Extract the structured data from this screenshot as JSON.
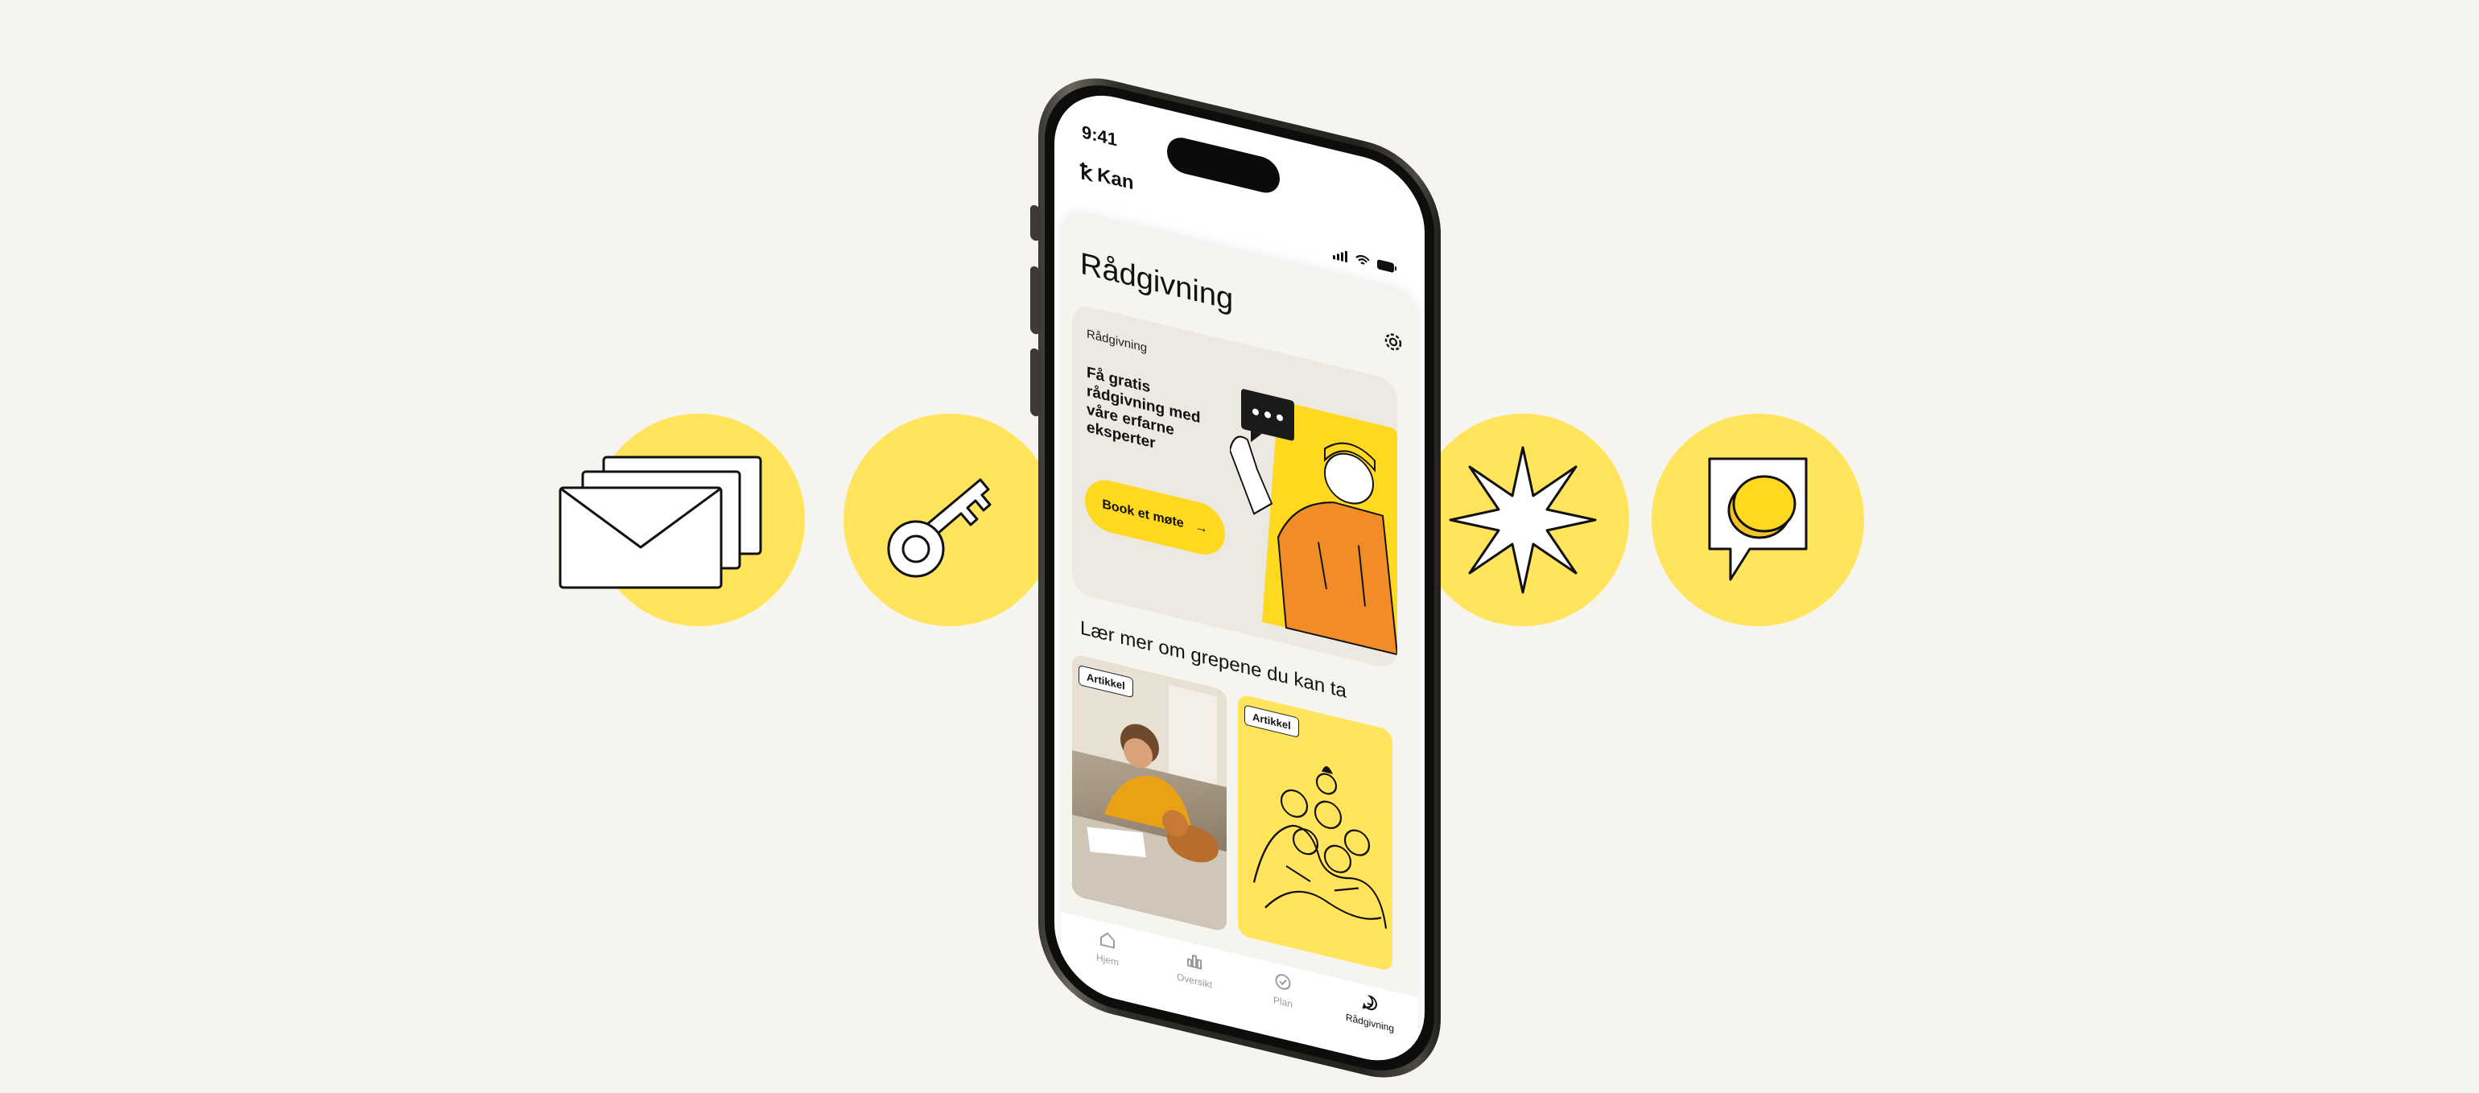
{
  "status_bar": {
    "time": "9:41"
  },
  "brand": {
    "name": "Kan"
  },
  "page": {
    "title": "Rådgivning"
  },
  "hero": {
    "tag": "Rådgivning",
    "text": "Få gratis rådgivning med våre erfarne eksperter",
    "button_label": "Book et møte"
  },
  "articles_section": {
    "title": "Lær mer om grepene du kan ta"
  },
  "articles": [
    {
      "tag": "Artikkel"
    },
    {
      "tag": "Artikkel"
    }
  ],
  "tabs": [
    {
      "label": "Hjem",
      "icon": "home-icon"
    },
    {
      "label": "Oversikt",
      "icon": "chart-icon"
    },
    {
      "label": "Plan",
      "icon": "check-circle-icon"
    },
    {
      "label": "Rådgivning",
      "icon": "chat-icon",
      "active": true
    }
  ],
  "floating_icons": [
    "envelopes-icon",
    "key-icon",
    "sparkle-icon",
    "coin-message-icon"
  ],
  "colors": {
    "accent": "#ffe45c",
    "button": "#ffd91f",
    "background": "#f6f4ef"
  }
}
